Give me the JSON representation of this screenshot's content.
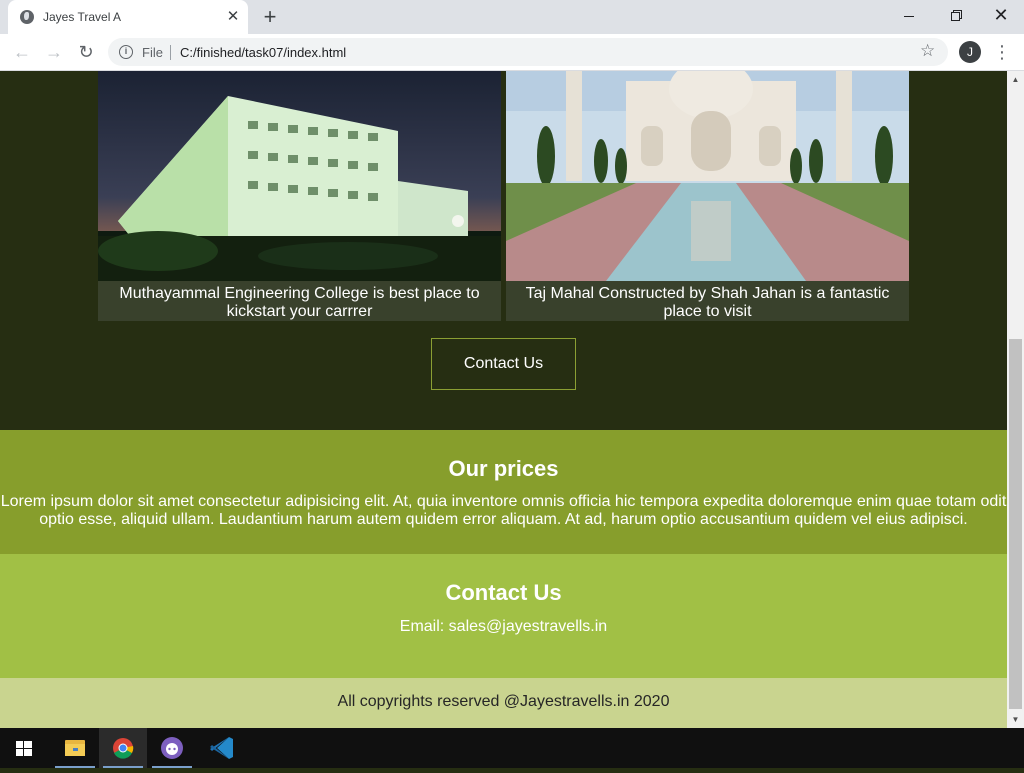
{
  "browser": {
    "tab_title": "Jayes Travel A",
    "tab_close": "✕",
    "new_tab": "+",
    "file_label": "File",
    "url": "C:/finished/task07/index.html",
    "profile_initial": "J"
  },
  "page": {
    "gallery": [
      {
        "caption": "Muthayammal Engineering College is best place to kickstart your carrrer"
      },
      {
        "caption": "Taj Mahal Constructed by Shah Jahan is a fantastic place to visit"
      }
    ],
    "contact_button": "Contact Us",
    "prices": {
      "heading": "Our prices",
      "text": "Lorem ipsum dolor sit amet consectetur adipisicing elit. At, quia inventore omnis officia hic tempora expedita doloremque enim quae totam odit optio esse, aliquid ullam. Laudantium harum autem quidem error aliquam. At ad, harum optio accusantium quidem vel eius adipisci."
    },
    "contact": {
      "heading": "Contact Us",
      "email": "Email: sales@jayestravells.in"
    },
    "footer": "All copyrights reserved @Jayestravells.in 2020"
  },
  "colors": {
    "dark_section": "#262e12",
    "prices_bg": "#879e2c",
    "contact_bg": "#a1c045",
    "footer_bg": "#c9d48f",
    "button_border": "#8b9f33"
  },
  "taskbar": {
    "icons": [
      "windows-start-icon",
      "file-explorer-icon",
      "chrome-icon",
      "github-desktop-icon",
      "vscode-icon"
    ]
  }
}
